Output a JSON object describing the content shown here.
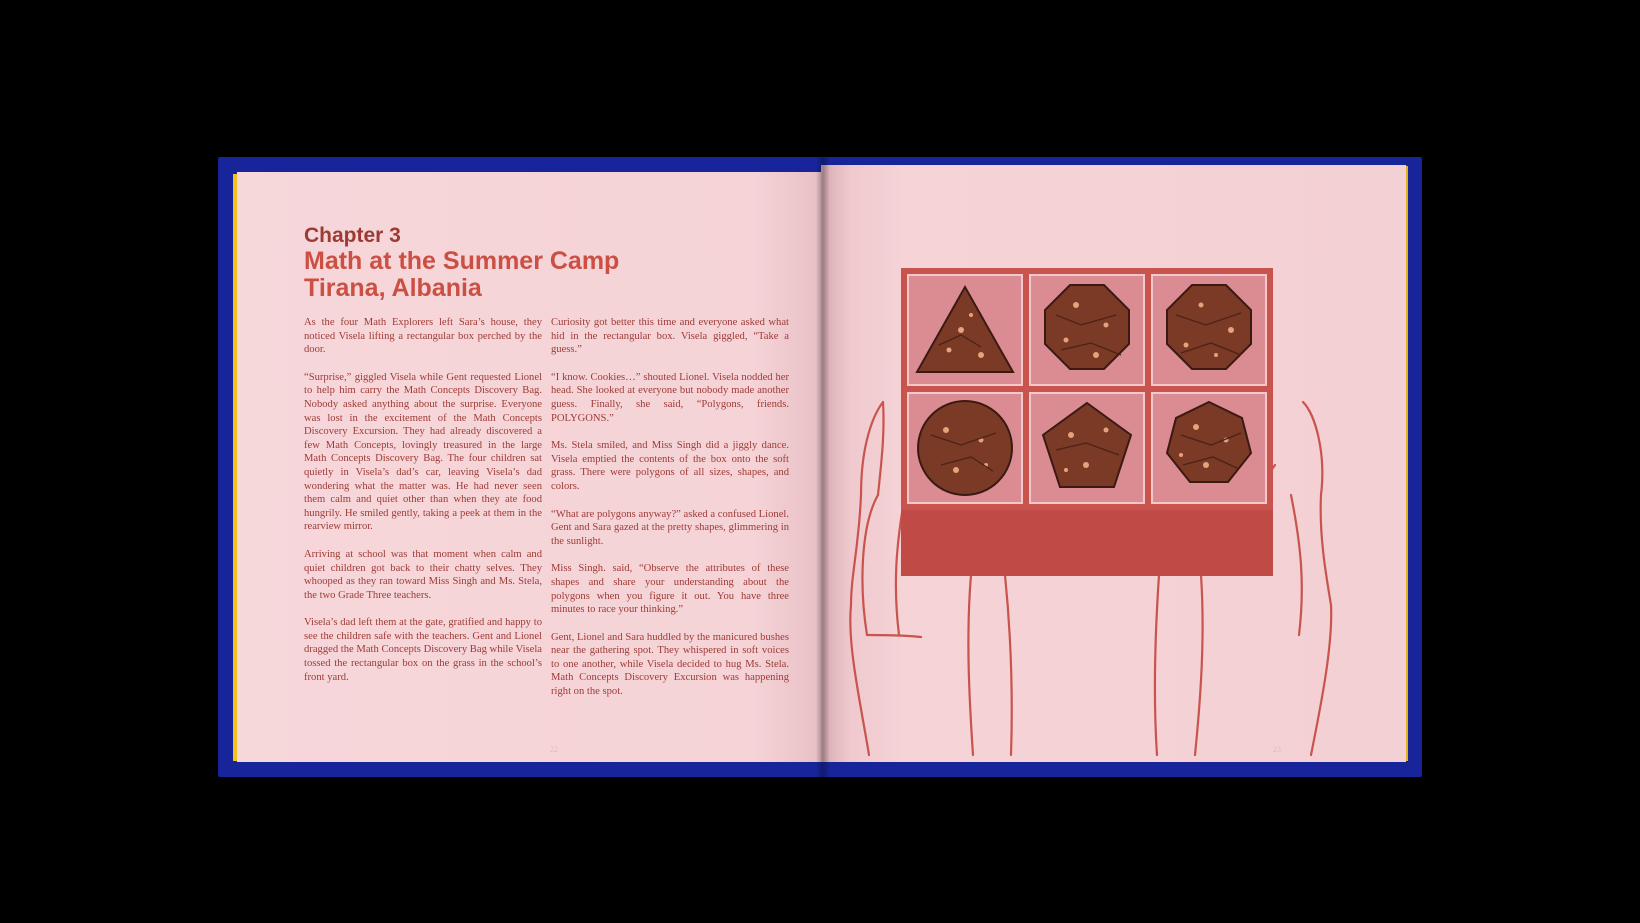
{
  "chapter": {
    "label": "Chapter 3",
    "title": "Math at the Summer Camp",
    "subtitle": "Tirana, Albania"
  },
  "left_column": [
    "As the four Math Explorers left Sara’s house, they noticed Visela lifting a rectangular box perched by the door.",
    "“Surprise,” giggled Visela while Gent requested Lionel to help him carry the Math Concepts Discovery Bag. Nobody asked anything about the surprise. Everyone was lost in the excitement of the Math Concepts Discovery Excursion. They had already discovered a few Math Concepts, lovingly treasured in the large Math Concepts Discovery Bag. The four children sat quietly in Visela’s dad’s car, leaving Visela’s dad wondering what the matter was. He had never seen them calm and quiet other than when they ate food hungrily. He smiled gently, taking a peek at them in the rearview mirror.",
    "Arriving at school was that moment when calm and quiet children got back to their chatty selves. They whooped as they ran toward Miss Singh and Ms. Stela, the two Grade Three teachers.",
    "Visela’s dad left them at the gate, gratified and happy to see the children safe with the teachers. Gent and Lionel dragged the Math Concepts Discovery Bag while Visela tossed the rectangular box on the grass in the school’s front yard."
  ],
  "right_column": [
    "Curiosity got better this time and everyone asked what hid in the rectangular box. Visela giggled, “Take a guess.”",
    "“I know. Cookies…” shouted Lionel. Visela nodded her head. She looked at everyone but nobody made another guess. Finally, she said, “Polygons, friends. POLYGONS.”",
    "Ms. Stela smiled, and Miss Singh did a jiggly dance. Visela emptied the contents of the box onto the soft grass. There were polygons of all sizes, shapes, and colors.",
    "“What are polygons anyway?” asked a confused Lionel. Gent and Sara gazed at the pretty shapes, glimmering in the sunlight.",
    "Miss Singh. said, “Observe the attributes of these shapes and share your understanding about the polygons when you figure it out. You have three minutes to race your thinking.”",
    "Gent, Lionel and Sara huddled by the manicured bushes near the gathering spot. They whispered in soft voices to one another, while Visela decided to hug Ms. Stela.  Math Concepts Discovery Excursion was happening right on the spot."
  ],
  "page_numbers": {
    "left": "22",
    "right": "23"
  },
  "colors": {
    "background": "#000000",
    "cover": "#17249a",
    "page": "#f5d3d7",
    "heading": "#cc4f43",
    "text": "#9e3a35",
    "box": "#c8544d",
    "cookie": "#7a3a26"
  },
  "illustration": {
    "cookie_shapes": [
      "triangle",
      "octagon",
      "octagon",
      "circle",
      "pentagon",
      "heptagon"
    ]
  }
}
